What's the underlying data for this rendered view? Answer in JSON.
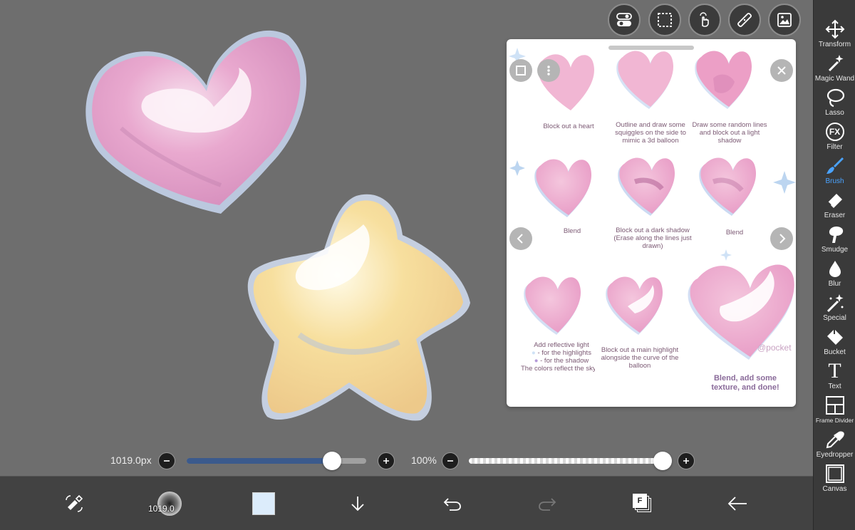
{
  "canvas": {
    "background": "#6e6e6e"
  },
  "top_toolbar": [
    {
      "name": "toggle-icon"
    },
    {
      "name": "selection-icon"
    },
    {
      "name": "gesture-icon"
    },
    {
      "name": "ruler-icon"
    },
    {
      "name": "material-icon"
    }
  ],
  "tools": [
    {
      "label": "Transform",
      "icon": "transform-icon"
    },
    {
      "label": "Magic Wand",
      "icon": "magic-wand-icon"
    },
    {
      "label": "Lasso",
      "icon": "lasso-icon"
    },
    {
      "label": "Filter",
      "icon": "fx-icon",
      "glyph": "FX"
    },
    {
      "label": "Brush",
      "icon": "brush-icon",
      "active": true
    },
    {
      "label": "Eraser",
      "icon": "eraser-icon"
    },
    {
      "label": "Smudge",
      "icon": "smudge-icon"
    },
    {
      "label": "Blur",
      "icon": "blur-icon"
    },
    {
      "label": "Special",
      "icon": "special-icon"
    },
    {
      "label": "Bucket",
      "icon": "bucket-icon"
    },
    {
      "label": "Text",
      "icon": "text-icon",
      "glyph": "T"
    },
    {
      "label": "Frame Divider",
      "icon": "frame-divider-icon"
    },
    {
      "label": "Eyedropper",
      "icon": "eyedropper-icon"
    },
    {
      "label": "Canvas",
      "icon": "canvas-icon"
    }
  ],
  "reference_panel": {
    "captions": [
      "Block out a heart",
      "Outline and draw some squiggles on the side to mimic a 3d balloon",
      "Draw some random lines and block out a light shadow",
      "Blend",
      "Block out a dark shadow (Erase along the lines just drawn)",
      "Blend",
      "Add  reflective light",
      "- for the highlights",
      "- for the shadow",
      "The colors reflect the sky",
      "Block out a main highlight alongside the curve of the balloon",
      "Blend, add some texture, and done!"
    ],
    "watermark": "@pocket"
  },
  "sliders": {
    "brush_size_label": "1019.0px",
    "brush_size_fraction": 0.81,
    "opacity_label": "100%",
    "opacity_fraction": 1.0,
    "size_color": "#3b5a8c"
  },
  "bottom_bar": {
    "brush_size_text": "1019.0",
    "color_swatch": "#dcecfb",
    "layers_glyph": "F"
  }
}
